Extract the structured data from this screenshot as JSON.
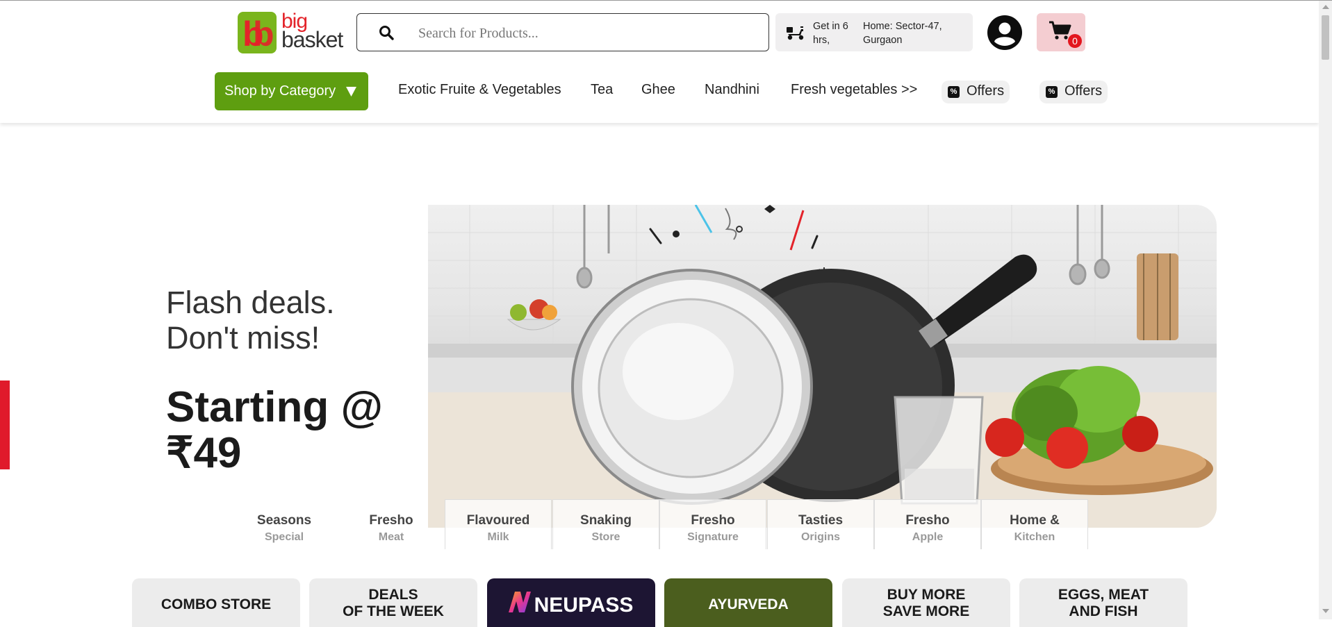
{
  "brand": {
    "logo_line1": "big",
    "logo_line2": "basket"
  },
  "search": {
    "placeholder": "Search for Products..."
  },
  "delivery": {
    "eta": "Get in 6 hrs,",
    "address": "Home: Sector-47, Gurgaon"
  },
  "cart": {
    "count": "0"
  },
  "nav": {
    "shop_by_category": "Shop by Category",
    "links": [
      "Exotic Fruite & Vegetables",
      "Tea",
      "Ghee",
      "Nandhini",
      "Fresh vegetables >>"
    ],
    "offers": [
      "Offers",
      "Offers"
    ]
  },
  "hero": {
    "line1": "Flash deals.",
    "line2": "Don't miss!",
    "big1": "Starting @",
    "big2": "₹49"
  },
  "carousel_tabs": [
    {
      "title": "Seasons",
      "subtitle": "Special"
    },
    {
      "title": "Fresho",
      "subtitle": "Meat"
    },
    {
      "title": "Flavoured",
      "subtitle": "Milk"
    },
    {
      "title": "Snaking",
      "subtitle": "Store"
    },
    {
      "title": "Fresho",
      "subtitle": "Signature"
    },
    {
      "title": "Tasties",
      "subtitle": "Origins"
    },
    {
      "title": "Fresho",
      "subtitle": "Apple"
    },
    {
      "title": "Home &",
      "subtitle": "Kitchen"
    }
  ],
  "store_tiles": [
    {
      "line1": "COMBO STORE",
      "line2": ""
    },
    {
      "line1": "DEALS",
      "line2": "OF THE WEEK"
    },
    {
      "line1": "NEUPASS",
      "line2": ""
    },
    {
      "line1": "AYURVEDA",
      "line2": ""
    },
    {
      "line1": "BUY MORE",
      "line2": "SAVE MORE"
    },
    {
      "line1": "EGGS, MEAT",
      "line2": "AND FISH"
    }
  ],
  "colors": {
    "brand_green": "#5e9e10",
    "brand_red": "#e3232a",
    "cart_bg": "#f4cdd1",
    "ayurveda_bg": "#4b5e1e",
    "neupass_bg": "#1d1533"
  }
}
